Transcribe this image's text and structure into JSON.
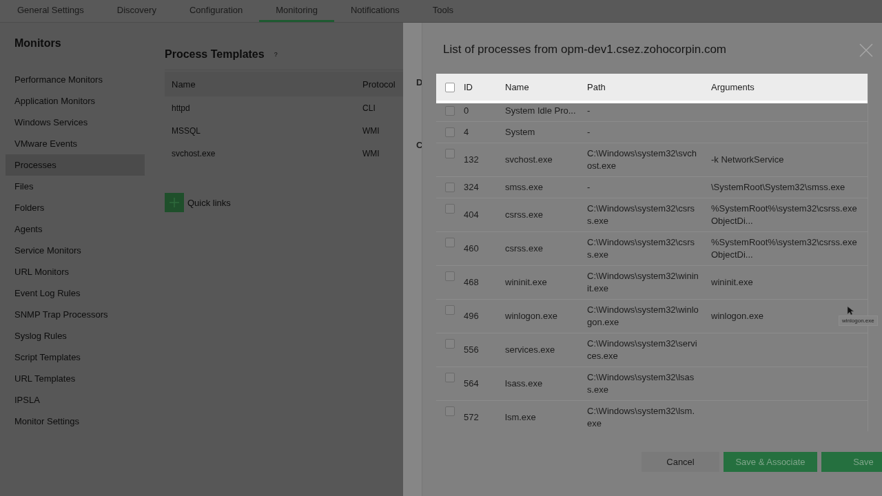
{
  "top_tabs": [
    {
      "label": "General Settings",
      "selected": false
    },
    {
      "label": "Discovery",
      "selected": false
    },
    {
      "label": "Configuration",
      "selected": false
    },
    {
      "label": "Monitoring",
      "selected": true
    },
    {
      "label": "Notifications",
      "selected": false
    },
    {
      "label": "Tools",
      "selected": false
    }
  ],
  "sidebar": {
    "title": "Monitors",
    "items": [
      {
        "label": "Performance Monitors",
        "selected": false
      },
      {
        "label": "Application Monitors",
        "selected": false
      },
      {
        "label": "Windows Services",
        "selected": false
      },
      {
        "label": "VMware Events",
        "selected": false
      },
      {
        "label": "Processes",
        "selected": true
      },
      {
        "label": "Files",
        "selected": false
      },
      {
        "label": "Folders",
        "selected": false
      },
      {
        "label": "Agents",
        "selected": false
      },
      {
        "label": "Service Monitors",
        "selected": false
      },
      {
        "label": "URL Monitors",
        "selected": false
      },
      {
        "label": "Event Log Rules",
        "selected": false
      },
      {
        "label": "SNMP Trap Processors",
        "selected": false
      },
      {
        "label": "Syslog Rules",
        "selected": false
      },
      {
        "label": "Script Templates",
        "selected": false
      },
      {
        "label": "URL Templates",
        "selected": false
      },
      {
        "label": "IPSLA",
        "selected": false
      },
      {
        "label": "Monitor Settings",
        "selected": false
      }
    ]
  },
  "content": {
    "title": "Process Templates",
    "help": "?",
    "table": {
      "columns": [
        "Name",
        "Protocol"
      ],
      "rows": [
        [
          "httpd",
          "CLI"
        ],
        [
          "MSSQL",
          "WMI"
        ],
        [
          "svchost.exe",
          "WMI"
        ]
      ]
    },
    "quick_links": "Quick links",
    "cut_labels": [
      "D",
      "C"
    ]
  },
  "dialog": {
    "title": "List of processes from opm-dev1.csez.zohocorpin.com",
    "table": {
      "header_highlighted": true,
      "select_all": {
        "checked": false
      },
      "columns": [
        "ID",
        "Name",
        "Path",
        "Arguments"
      ],
      "rows": [
        {
          "checked": false,
          "id": "0",
          "name": "System Idle Pro...",
          "path": "-"
        },
        {
          "checked": false,
          "id": "4",
          "name": "System",
          "path": "-"
        },
        {
          "checked": false,
          "id": "132",
          "name": "svchost.exe",
          "path": "C:\\Windows\\system32\\svchost.exe",
          "arguments": "-k NetworkService"
        },
        {
          "checked": false,
          "id": "324",
          "name": "smss.exe",
          "path": "-",
          "arguments": "\\SystemRoot\\System32\\smss.exe"
        },
        {
          "checked": false,
          "id": "404",
          "name": "csrss.exe",
          "path": "C:\\Windows\\system32\\csrss.exe",
          "arguments": "%SystemRoot%\\system32\\csrss.exe ObjectDi..."
        },
        {
          "checked": false,
          "id": "460",
          "name": "csrss.exe",
          "path": "C:\\Windows\\system32\\csrss.exe",
          "arguments": "%SystemRoot%\\system32\\csrss.exe ObjectDi..."
        },
        {
          "checked": false,
          "id": "468",
          "name": "wininit.exe",
          "path": "C:\\Windows\\system32\\wininit.exe",
          "arguments": "wininit.exe"
        },
        {
          "checked": false,
          "id": "496",
          "name": "winlogon.exe",
          "path": "C:\\Windows\\system32\\winlogon.exe",
          "arguments": "winlogon.exe"
        },
        {
          "checked": false,
          "id": "556",
          "name": "services.exe",
          "path": "C:\\Windows\\system32\\services.exe"
        },
        {
          "checked": false,
          "id": "564",
          "name": "lsass.exe",
          "path": "C:\\Windows\\system32\\lsass.exe"
        },
        {
          "checked": false,
          "id": "572",
          "name": "lsm.exe",
          "path": "C:\\Windows\\system32\\lsm.exe"
        }
      ]
    },
    "tooltip": "winlogon.exe",
    "buttons": [
      {
        "label": "Cancel",
        "kind": "secondary"
      },
      {
        "label": "Save & Associate",
        "kind": "primary"
      },
      {
        "label": "Save",
        "kind": "primary"
      }
    ]
  }
}
